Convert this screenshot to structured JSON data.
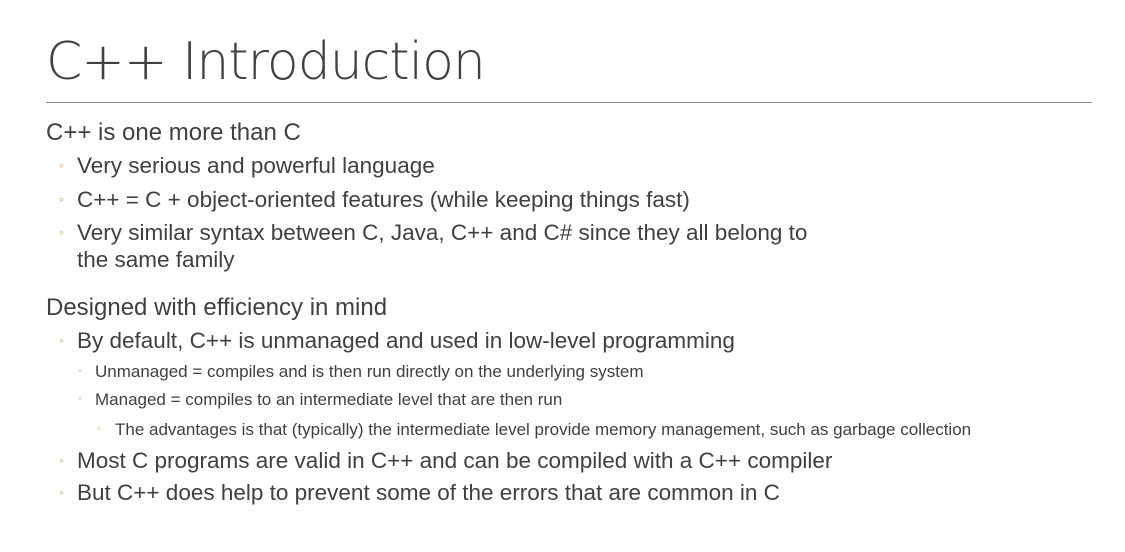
{
  "slide": {
    "title": "C++ Introduction",
    "bullet_color": "#e0a050",
    "items": [
      {
        "level": 1,
        "text": "C++ is one more than C"
      },
      {
        "level": 2,
        "text": "Very serious and powerful language"
      },
      {
        "level": 2,
        "text": "C++ = C + object-oriented features (while keeping things fast)"
      },
      {
        "level": 2,
        "text": "Very similar syntax between C, Java, C++ and C# since they all belong to"
      },
      {
        "level": 2,
        "text": "the same family"
      },
      {
        "level": 1,
        "text": "Designed with efficiency in mind"
      },
      {
        "level": 2,
        "text": "By default, C++ is unmanaged and used in low-level programming"
      },
      {
        "level": 3,
        "text": "Unmanaged = compiles and is then run directly on the underlying system"
      },
      {
        "level": 3,
        "text": "Managed = compiles to an intermediate level that are then run"
      },
      {
        "level": 4,
        "text": "The advantages is that (typically) the intermediate level provide memory management, such as garbage collection"
      },
      {
        "level": 2,
        "text": "Most C programs are valid in C++ and can be compiled with a C++ compiler"
      },
      {
        "level": 2,
        "text": "But C++ does help to prevent some of the errors that are common in C"
      }
    ]
  }
}
